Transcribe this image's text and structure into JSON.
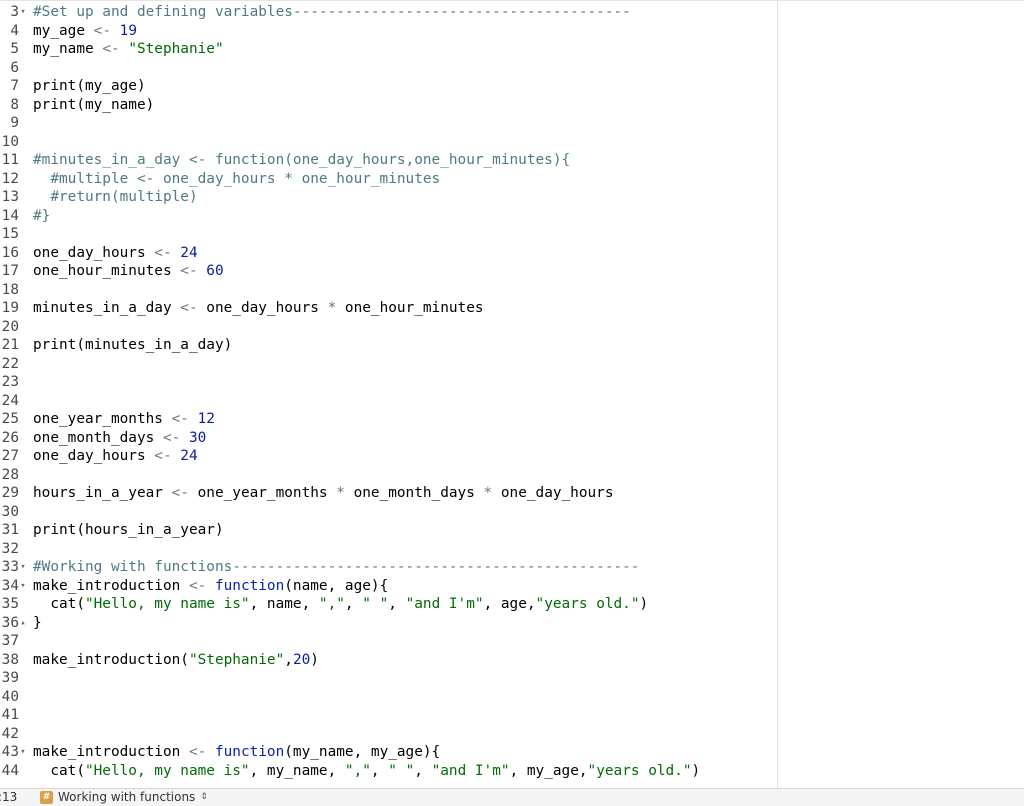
{
  "editor": {
    "lines": [
      {
        "n": "3",
        "fold": "down",
        "t": [
          {
            "c": "c",
            "v": "#Set up and defining variables---------------------------------------"
          }
        ]
      },
      {
        "n": "4",
        "t": [
          {
            "c": "p",
            "v": "my_age "
          },
          {
            "c": "o",
            "v": "<- "
          },
          {
            "c": "n",
            "v": "19"
          }
        ]
      },
      {
        "n": "5",
        "t": [
          {
            "c": "p",
            "v": "my_name "
          },
          {
            "c": "o",
            "v": "<- "
          },
          {
            "c": "s",
            "v": "\"Stephanie\""
          }
        ]
      },
      {
        "n": "6",
        "t": []
      },
      {
        "n": "7",
        "t": [
          {
            "c": "p",
            "v": "print(my_age)"
          }
        ]
      },
      {
        "n": "8",
        "t": [
          {
            "c": "p",
            "v": "print(my_name)"
          }
        ]
      },
      {
        "n": "9",
        "t": []
      },
      {
        "n": "10",
        "t": []
      },
      {
        "n": "11",
        "t": [
          {
            "c": "c",
            "v": "#minutes_in_a_day <- function(one_day_hours,one_hour_minutes){"
          }
        ]
      },
      {
        "n": "12",
        "t": [
          {
            "c": "c",
            "v": "  #multiple <- one_day_hours * one_hour_minutes"
          }
        ]
      },
      {
        "n": "13",
        "t": [
          {
            "c": "c",
            "v": "  #return(multiple)"
          }
        ]
      },
      {
        "n": "14",
        "t": [
          {
            "c": "c",
            "v": "#}"
          }
        ]
      },
      {
        "n": "15",
        "t": []
      },
      {
        "n": "16",
        "t": [
          {
            "c": "p",
            "v": "one_day_hours "
          },
          {
            "c": "o",
            "v": "<- "
          },
          {
            "c": "n",
            "v": "24"
          }
        ]
      },
      {
        "n": "17",
        "t": [
          {
            "c": "p",
            "v": "one_hour_minutes "
          },
          {
            "c": "o",
            "v": "<- "
          },
          {
            "c": "n",
            "v": "60"
          }
        ]
      },
      {
        "n": "18",
        "t": []
      },
      {
        "n": "19",
        "t": [
          {
            "c": "p",
            "v": "minutes_in_a_day "
          },
          {
            "c": "o",
            "v": "<- "
          },
          {
            "c": "p",
            "v": "one_day_hours "
          },
          {
            "c": "o",
            "v": "* "
          },
          {
            "c": "p",
            "v": "one_hour_minutes"
          }
        ]
      },
      {
        "n": "20",
        "t": []
      },
      {
        "n": "21",
        "t": [
          {
            "c": "p",
            "v": "print(minutes_in_a_day)"
          }
        ]
      },
      {
        "n": "22",
        "t": []
      },
      {
        "n": "23",
        "t": []
      },
      {
        "n": "24",
        "t": []
      },
      {
        "n": "25",
        "t": [
          {
            "c": "p",
            "v": "one_year_months "
          },
          {
            "c": "o",
            "v": "<- "
          },
          {
            "c": "n",
            "v": "12"
          }
        ]
      },
      {
        "n": "26",
        "t": [
          {
            "c": "p",
            "v": "one_month_days "
          },
          {
            "c": "o",
            "v": "<- "
          },
          {
            "c": "n",
            "v": "30"
          }
        ]
      },
      {
        "n": "27",
        "t": [
          {
            "c": "p",
            "v": "one_day_hours "
          },
          {
            "c": "o",
            "v": "<- "
          },
          {
            "c": "n",
            "v": "24"
          }
        ]
      },
      {
        "n": "28",
        "t": []
      },
      {
        "n": "29",
        "t": [
          {
            "c": "p",
            "v": "hours_in_a_year "
          },
          {
            "c": "o",
            "v": "<- "
          },
          {
            "c": "p",
            "v": "one_year_months "
          },
          {
            "c": "o",
            "v": "* "
          },
          {
            "c": "p",
            "v": "one_month_days "
          },
          {
            "c": "o",
            "v": "* "
          },
          {
            "c": "p",
            "v": "one_day_hours"
          }
        ]
      },
      {
        "n": "30",
        "t": []
      },
      {
        "n": "31",
        "t": [
          {
            "c": "p",
            "v": "print(hours_in_a_year)"
          }
        ]
      },
      {
        "n": "32",
        "t": []
      },
      {
        "n": "33",
        "fold": "down",
        "t": [
          {
            "c": "c",
            "v": "#Working with functions-----------------------------------------------"
          }
        ]
      },
      {
        "n": "34",
        "fold": "down",
        "t": [
          {
            "c": "p",
            "v": "make_introduction "
          },
          {
            "c": "o",
            "v": "<- "
          },
          {
            "c": "k",
            "v": "function"
          },
          {
            "c": "p",
            "v": "(name, age){"
          }
        ]
      },
      {
        "n": "35",
        "t": [
          {
            "c": "p",
            "v": "  cat("
          },
          {
            "c": "s",
            "v": "\"Hello, my name is\""
          },
          {
            "c": "p",
            "v": ", name, "
          },
          {
            "c": "s",
            "v": "\",\""
          },
          {
            "c": "p",
            "v": ", "
          },
          {
            "c": "s",
            "v": "\" \""
          },
          {
            "c": "p",
            "v": ", "
          },
          {
            "c": "s",
            "v": "\"and I'm\""
          },
          {
            "c": "p",
            "v": ", age,"
          },
          {
            "c": "s",
            "v": "\"years old.\""
          },
          {
            "c": "p",
            "v": ")"
          }
        ]
      },
      {
        "n": "36",
        "fold": "up",
        "t": [
          {
            "c": "p",
            "v": "}"
          }
        ]
      },
      {
        "n": "37",
        "t": []
      },
      {
        "n": "38",
        "t": [
          {
            "c": "p",
            "v": "make_introduction("
          },
          {
            "c": "s",
            "v": "\"Stephanie\""
          },
          {
            "c": "p",
            "v": ","
          },
          {
            "c": "n",
            "v": "20"
          },
          {
            "c": "p",
            "v": ")"
          }
        ]
      },
      {
        "n": "39",
        "t": []
      },
      {
        "n": "40",
        "t": []
      },
      {
        "n": "41",
        "t": []
      },
      {
        "n": "42",
        "t": []
      },
      {
        "n": "43",
        "fold": "down",
        "t": [
          {
            "c": "p",
            "v": "make_introduction "
          },
          {
            "c": "o",
            "v": "<- "
          },
          {
            "c": "k",
            "v": "function"
          },
          {
            "c": "p",
            "v": "(my_name, my_age){"
          }
        ]
      },
      {
        "n": "44",
        "t": [
          {
            "c": "p",
            "v": "  cat("
          },
          {
            "c": "s",
            "v": "\"Hello, my name is\""
          },
          {
            "c": "p",
            "v": ", my_name, "
          },
          {
            "c": "s",
            "v": "\",\""
          },
          {
            "c": "p",
            "v": ", "
          },
          {
            "c": "s",
            "v": "\" \""
          },
          {
            "c": "p",
            "v": ", "
          },
          {
            "c": "s",
            "v": "\"and I'm\""
          },
          {
            "c": "p",
            "v": ", my_age,"
          },
          {
            "c": "s",
            "v": "\"years old.\""
          },
          {
            "c": "p",
            "v": ")"
          }
        ]
      }
    ]
  },
  "status": {
    "position": ":13",
    "section_icon": "hash-section-icon",
    "section": "Working with functions",
    "section_arrows": "⇕"
  }
}
